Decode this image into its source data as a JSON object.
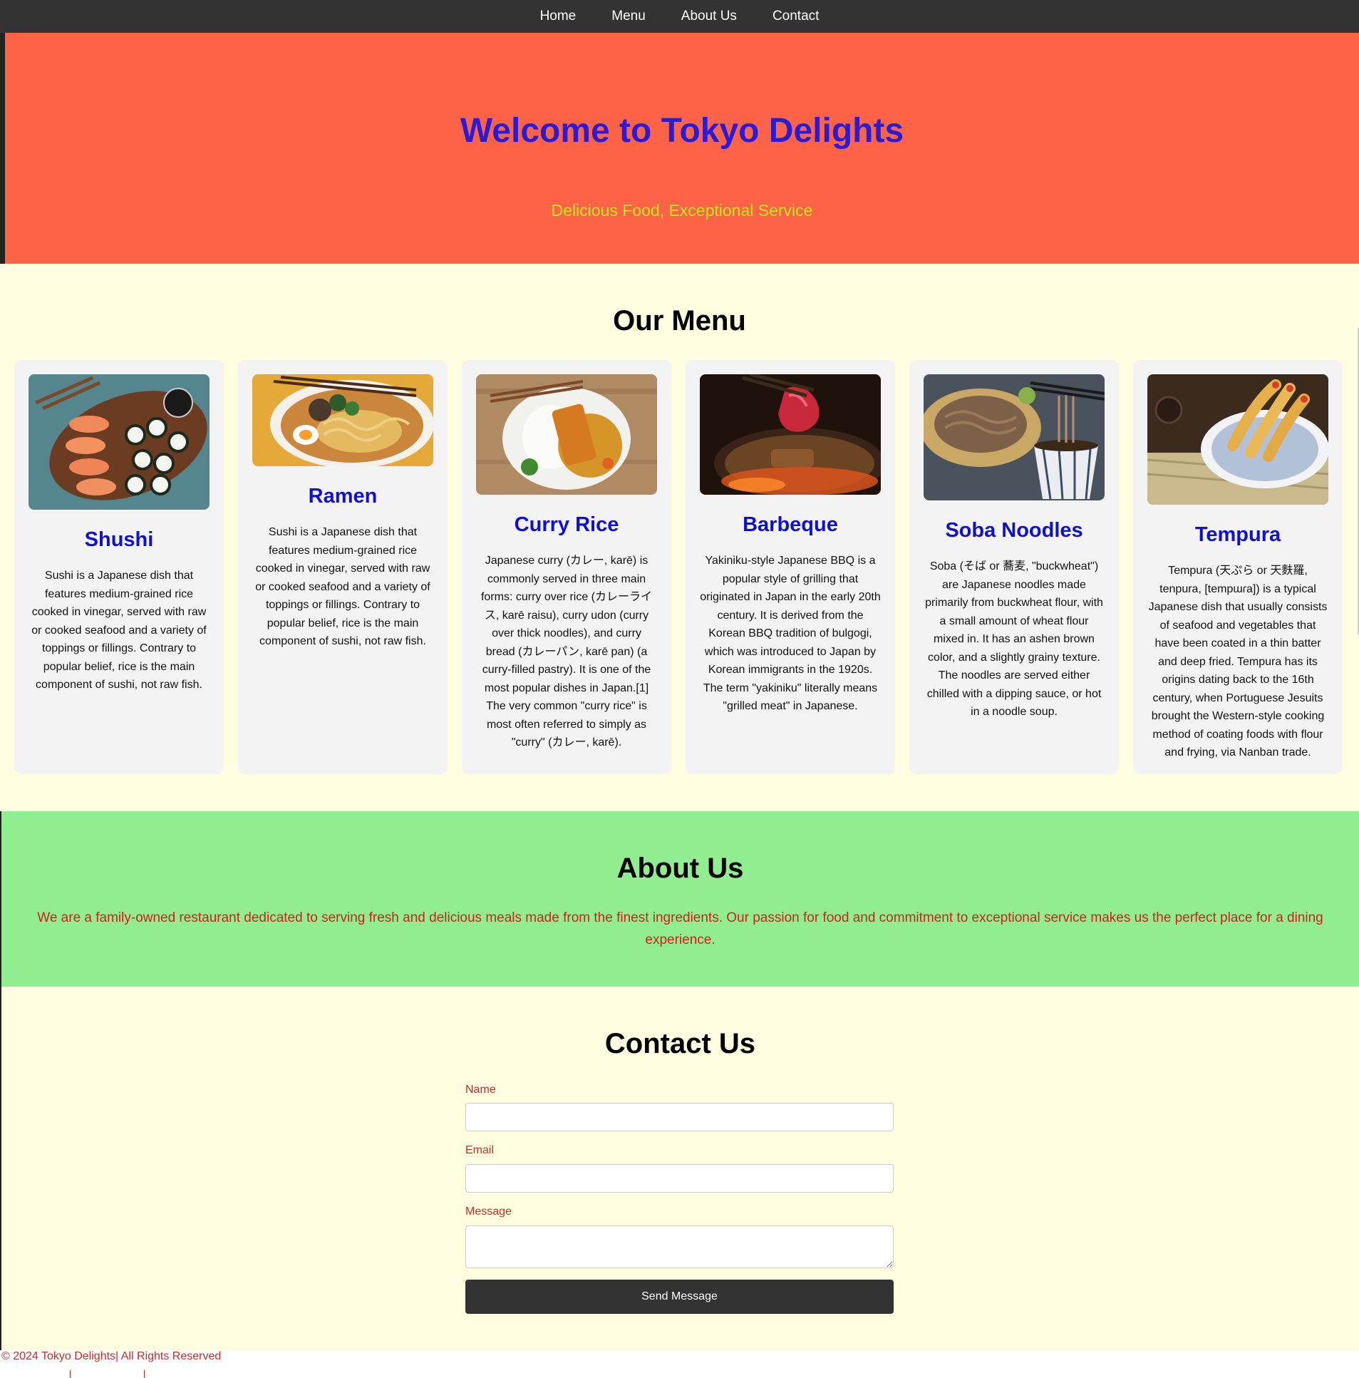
{
  "nav": {
    "items": [
      "Home",
      "Menu",
      "About Us",
      "Contact"
    ]
  },
  "hero": {
    "title": "Welcome to Tokyo Delights",
    "subtitle": "Delicious Food, Exceptional Service"
  },
  "menu": {
    "heading": "Our Menu",
    "items": [
      {
        "name": "Shushi",
        "image_icon": "sushi-photo",
        "description": "Sushi is a Japanese dish that features medium-grained rice cooked in vinegar, served with raw or cooked seafood and a variety of toppings or fillings. Contrary to popular belief, rice is the main component of sushi, not raw fish."
      },
      {
        "name": "Ramen",
        "image_icon": "ramen-photo",
        "description": "Sushi is a Japanese dish that features medium-grained rice cooked in vinegar, served with raw or cooked seafood and a variety of toppings or fillings. Contrary to popular belief, rice is the main component of sushi, not raw fish."
      },
      {
        "name": "Curry Rice",
        "image_icon": "curry-rice-photo",
        "description": "Japanese curry (カレー, karē) is commonly served in three main forms: curry over rice (カレーライス, karē raisu), curry udon (curry over thick noodles), and curry bread (カレーパン, karē pan) (a curry-filled pastry). It is one of the most popular dishes in Japan.[1] The very common \"curry rice\" is most often referred to simply as \"curry\" (カレー, karē)."
      },
      {
        "name": "Barbeque",
        "image_icon": "barbeque-photo",
        "description": "Yakiniku-style Japanese BBQ is a popular style of grilling that originated in Japan in the early 20th century. It is derived from the Korean BBQ tradition of bulgogi, which was introduced to Japan by Korean immigrants in the 1920s. The term \"yakiniku\" literally means \"grilled meat\" in Japanese."
      },
      {
        "name": "Soba Noodles",
        "image_icon": "soba-noodles-photo",
        "description": "Soba (そば or 蕎麦, \"buckwheat\") are Japanese noodles made primarily from buckwheat flour, with a small amount of wheat flour mixed in. It has an ashen brown color, and a slightly grainy texture. The noodles are served either chilled with a dipping sauce, or hot in a noodle soup."
      },
      {
        "name": "Tempura",
        "image_icon": "tempura-photo",
        "description": "Tempura (天ぷら or 天麩羅, tenpura, [tempɯɾa]) is a typical Japanese dish that usually consists of seafood and vegetables that have been coated in a thin batter and deep fried. Tempura has its origins dating back to the 16th century, when Portuguese Jesuits brought the Western-style cooking method of coating foods with flour and frying, via Nanban trade."
      }
    ]
  },
  "about": {
    "heading": "About Us",
    "text": "We are a family-owned restaurant dedicated to serving fresh and delicious meals made from the finest ingredients. Our passion for food and commitment to exceptional service makes us the perfect place for a dining experience."
  },
  "contact": {
    "heading": "Contact Us",
    "name_label": "Name",
    "email_label": "Email",
    "message_label": "Message",
    "name_value": "",
    "email_value": "",
    "message_value": "",
    "submit_label": "Send Message"
  },
  "footer": {
    "text": "© 2024 Tokyo Delights| All Rights Reserved"
  },
  "colors": {
    "nav_bg": "#333333",
    "hero_bg": "#ff6347",
    "hero_title": "#2a1bd6",
    "hero_subtitle": "#c8e61e",
    "section_bg": "#fffde0",
    "card_bg": "#f3f3f3",
    "card_title": "#1010d0",
    "about_bg": "#90ee90",
    "accent_red": "#d02020"
  }
}
